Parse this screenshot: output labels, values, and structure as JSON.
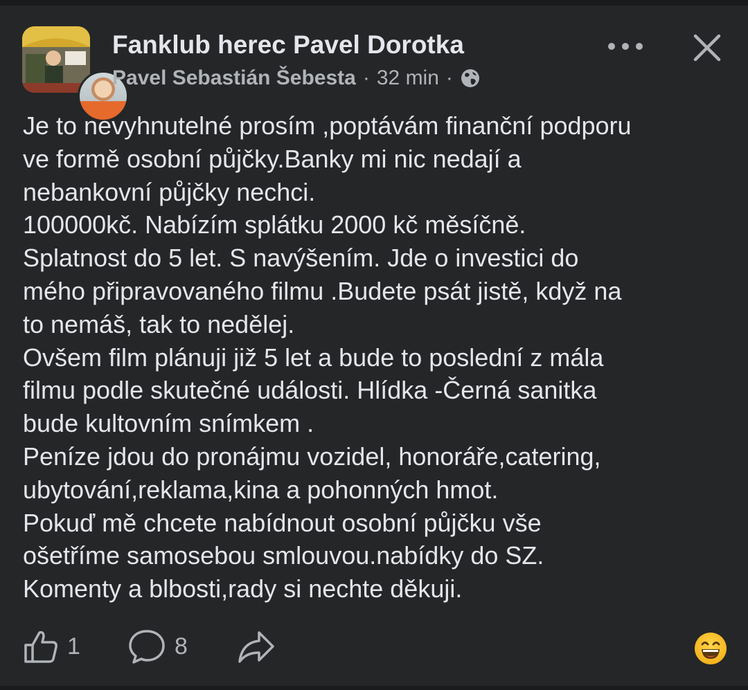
{
  "header": {
    "group_name": "Fanklub herec Pavel Dorotka",
    "author": "Pavel Sebastián Šebesta",
    "separator": "·",
    "time": "32 min",
    "privacy_icon": "globe-icon",
    "more_icon": "more-horizontal-icon",
    "close_icon": "close-icon"
  },
  "post": {
    "lines": [
      "Je to nevyhnutelné prosím ,poptávám finanční podporu",
      "ve formě osobní půjčky.Banky mi nic nedají a",
      "nebankovní půjčky nechci.",
      "100000kč. Nabízím splátku 2000 kč měsíčně.",
      "Splatnost do 5 let. S navýšením. Jde o investici do",
      "mého připravovaného filmu .Budete psát jistě, když na",
      "to nemáš, tak to nedělej.",
      "Ovšem film plánuji již 5 let a bude to poslední z mála",
      "filmu podle skutečné události. Hlídka -Černá sanitka",
      "bude kultovním snímkem .",
      "Peníze jdou do pronájmu vozidel, honoráře,catering,",
      "ubytování,reklama,kina a pohonných hmot.",
      "Pokuď mě chcete nabídnout osobní půjčku vše",
      "ošetříme samosebou smlouvou.nabídky do SZ.",
      "Komenty a blbosti,rady si nechte děkuji."
    ]
  },
  "footer": {
    "like_count": "1",
    "comment_count": "8",
    "like_icon": "thumbs-up-icon",
    "comment_icon": "comment-bubble-icon",
    "share_icon": "share-arrow-icon",
    "reaction_icon": "laughing-emoji-icon"
  },
  "colors": {
    "background": "#252628",
    "text": "#e4e6eb",
    "secondary": "#b0b3b8"
  }
}
